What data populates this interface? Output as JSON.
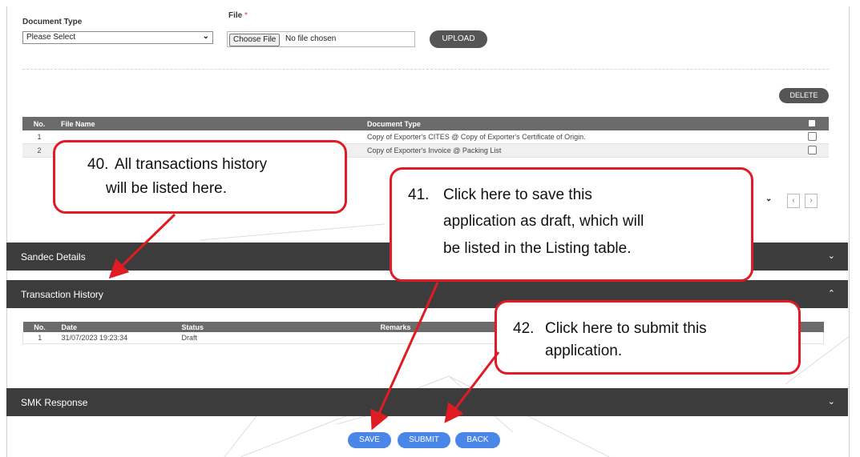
{
  "upload_form": {
    "doc_type_label": "Document Type",
    "doc_type_value": "Please Select",
    "file_label": "File",
    "file_required": "*",
    "choose_file_label": "Choose File",
    "no_file_text": "No file chosen",
    "upload_label": "UPLOAD"
  },
  "delete_label": "DELETE",
  "documents_table": {
    "headers": [
      "No.",
      "File Name",
      "Document Type"
    ],
    "rows": [
      {
        "no": "1",
        "file_name": "",
        "doc_type": "Copy of Exporter's CITES @ Copy of Exporter's Certificate of Origin."
      },
      {
        "no": "2",
        "file_name": "",
        "doc_type": "Copy of Exporter's Invoice @ Packing List"
      }
    ]
  },
  "sections": {
    "sandec": "Sandec Details",
    "transaction_history": "Transaction History",
    "smk_response": "SMK Response"
  },
  "history_table": {
    "headers": [
      "No.",
      "Date",
      "Status",
      "Remarks"
    ],
    "rows": [
      {
        "no": "1",
        "date": "31/07/2023 19:23:34",
        "status": "Draft",
        "remarks": ""
      }
    ]
  },
  "actions": {
    "save": "SAVE",
    "submit": "SUBMIT",
    "back": "BACK"
  },
  "callouts": {
    "c40": {
      "num": "40.",
      "line1": "All transactions history",
      "line2": "will be listed here."
    },
    "c41": {
      "num": "41.",
      "line1": "Click here to save this",
      "line2": "application as draft, which will",
      "line3": "be listed in the Listing table."
    },
    "c42": {
      "num": "42.",
      "line1": "Click here to submit this",
      "line2": "application."
    }
  },
  "colors": {
    "header_dark": "#3c3c3c",
    "table_header": "#6b6b6b",
    "action_blue": "#4a86e8",
    "callout_red": "#e01b24"
  }
}
